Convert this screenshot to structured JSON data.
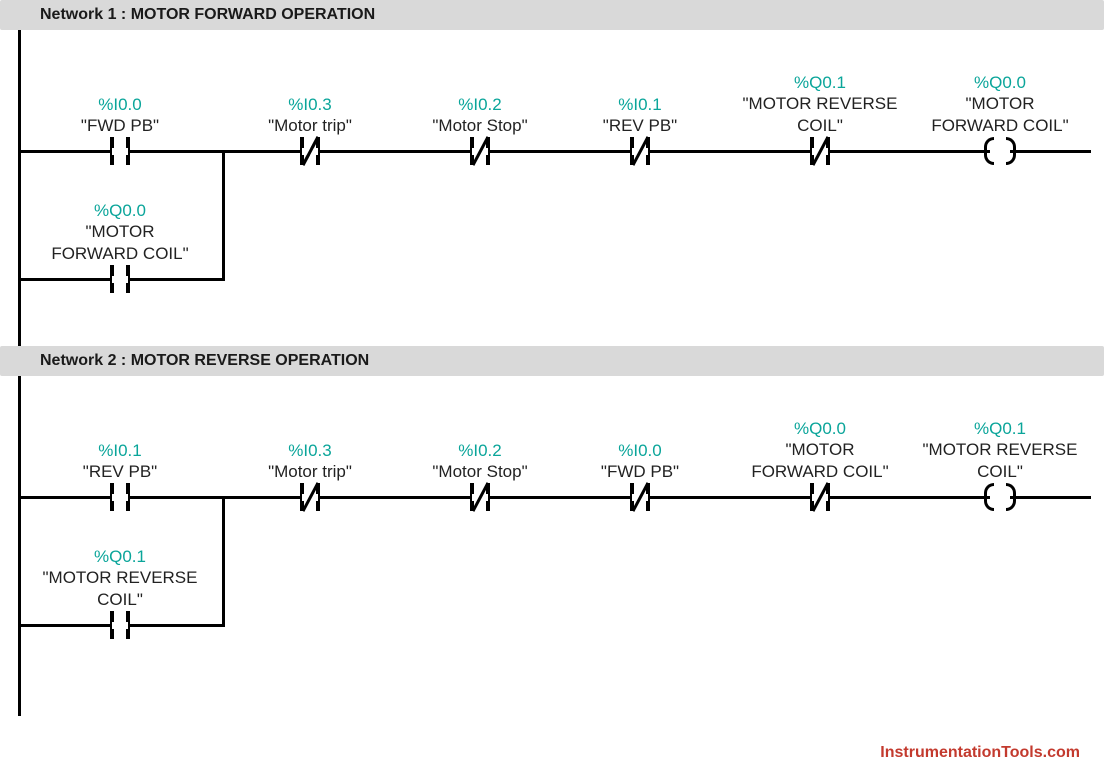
{
  "networks": [
    {
      "title_prefix": "Network 1 : ",
      "title_bold": "MOTOR FORWARD OPERATION",
      "elements": [
        {
          "addr": "%I0.0",
          "name": "\"FWD PB\""
        },
        {
          "addr": "%I0.3",
          "name": "\"Motor trip\""
        },
        {
          "addr": "%I0.2",
          "name": "\"Motor Stop\""
        },
        {
          "addr": "%I0.1",
          "name": "\"REV PB\""
        },
        {
          "addr": "%Q0.1",
          "name": "\"MOTOR REVERSE COIL\""
        },
        {
          "addr": "%Q0.0",
          "name": "\"MOTOR FORWARD COIL\""
        }
      ],
      "branch": {
        "addr": "%Q0.0",
        "name": "\"MOTOR FORWARD COIL\""
      }
    },
    {
      "title_prefix": "Network 2 : ",
      "title_bold": "MOTOR REVERSE OPERATION",
      "elements": [
        {
          "addr": "%I0.1",
          "name": "\"REV PB\""
        },
        {
          "addr": "%I0.3",
          "name": "\"Motor trip\""
        },
        {
          "addr": "%I0.2",
          "name": "\"Motor Stop\""
        },
        {
          "addr": "%I0.0",
          "name": "\"FWD PB\""
        },
        {
          "addr": "%Q0.0",
          "name": "\"MOTOR FORWARD COIL\""
        },
        {
          "addr": "%Q0.1",
          "name": "\"MOTOR REVERSE COIL\""
        }
      ],
      "branch": {
        "addr": "%Q0.1",
        "name": "\"MOTOR REVERSE COIL\""
      }
    }
  ],
  "watermark": "InstrumentationTools.com"
}
